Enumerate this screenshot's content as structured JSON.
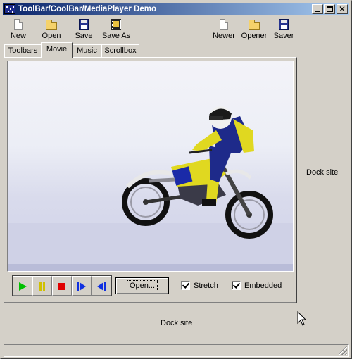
{
  "window": {
    "title": "ToolBar/CoolBar/MediaPlayer Demo",
    "close_glyph": "✕"
  },
  "toolbar": {
    "buttons": [
      {
        "label": "New",
        "icon": "new-document-icon"
      },
      {
        "label": "Open",
        "icon": "open-folder-icon"
      },
      {
        "label": "Save",
        "icon": "save-disk-icon"
      },
      {
        "label": "Save As",
        "icon": "save-as-film-icon"
      },
      {
        "label": "Newer",
        "icon": "new-document-icon"
      },
      {
        "label": "Opener",
        "icon": "open-folder-icon"
      },
      {
        "label": "Saver",
        "icon": "save-disk-icon"
      }
    ]
  },
  "tabs": [
    {
      "label": "Toolbars",
      "active": false
    },
    {
      "label": "Movie",
      "active": true
    },
    {
      "label": "Music",
      "active": false
    },
    {
      "label": "Scrollbox",
      "active": false
    }
  ],
  "media_player": {
    "buttons": [
      {
        "name": "play",
        "icon": "play-icon",
        "color": "#00c000"
      },
      {
        "name": "pause",
        "icon": "pause-icon",
        "color": "#d0c000"
      },
      {
        "name": "stop",
        "icon": "stop-icon",
        "color": "#e00000"
      },
      {
        "name": "next",
        "icon": "step-forward-icon",
        "color": "#1030e0"
      },
      {
        "name": "back",
        "icon": "step-back-icon",
        "color": "#1030e0"
      }
    ],
    "open_label": "Open...",
    "stretch_label": "Stretch",
    "stretch_checked": true,
    "embedded_label": "Embedded",
    "embedded_checked": true
  },
  "dock": {
    "right_label": "Dock site",
    "bottom_label": "Dock site"
  },
  "colors": {
    "title_gradient_start": "#0a246a",
    "title_gradient_end": "#a6caf0",
    "face": "#d4d0c8"
  }
}
